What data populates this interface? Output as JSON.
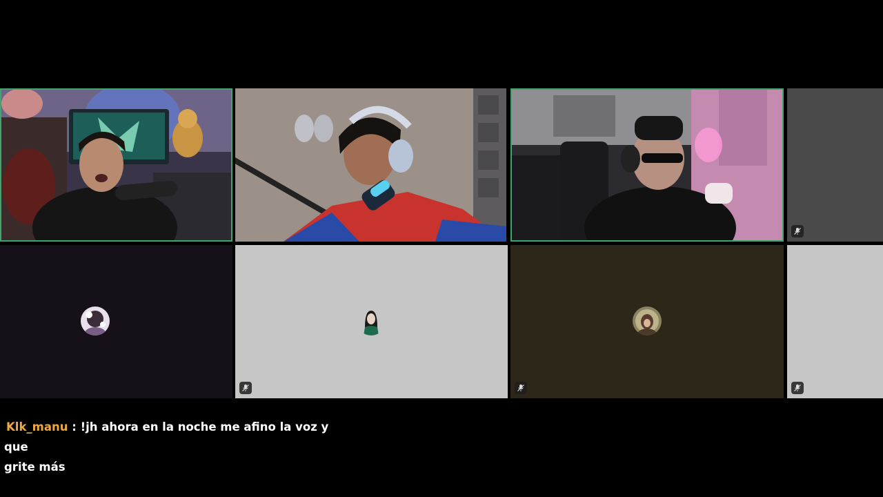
{
  "tiles": [
    {
      "id": "cam-1",
      "type": "video",
      "speaking": true,
      "muted": false
    },
    {
      "id": "cam-2",
      "type": "video",
      "speaking": false,
      "muted": false
    },
    {
      "id": "cam-3",
      "type": "video",
      "speaking": true,
      "muted": false
    },
    {
      "id": "cam-4",
      "type": "empty",
      "speaking": false,
      "muted": true,
      "bg": "#4a4a4a"
    },
    {
      "id": "audio-1",
      "type": "avatar",
      "speaking": false,
      "muted": false,
      "bg": "#161118"
    },
    {
      "id": "audio-2",
      "type": "avatar",
      "speaking": false,
      "muted": true,
      "bg": "#c6c6c6"
    },
    {
      "id": "audio-3",
      "type": "avatar",
      "speaking": false,
      "muted": true,
      "bg": "#2c2718"
    },
    {
      "id": "audio-4",
      "type": "empty",
      "speaking": false,
      "muted": true,
      "bg": "#c6c6c6"
    }
  ],
  "icons": {
    "muted": "mic-off-icon"
  },
  "colors": {
    "speaking_border": "#3ea66a",
    "chat_username": "#f2a93b",
    "chat_text": "#ffffff"
  },
  "chat": {
    "username": "Klk_manu",
    "separator": " : ",
    "message_line1": "!jh ahora en la noche me afino la voz y que",
    "message_line2": "grite más"
  }
}
